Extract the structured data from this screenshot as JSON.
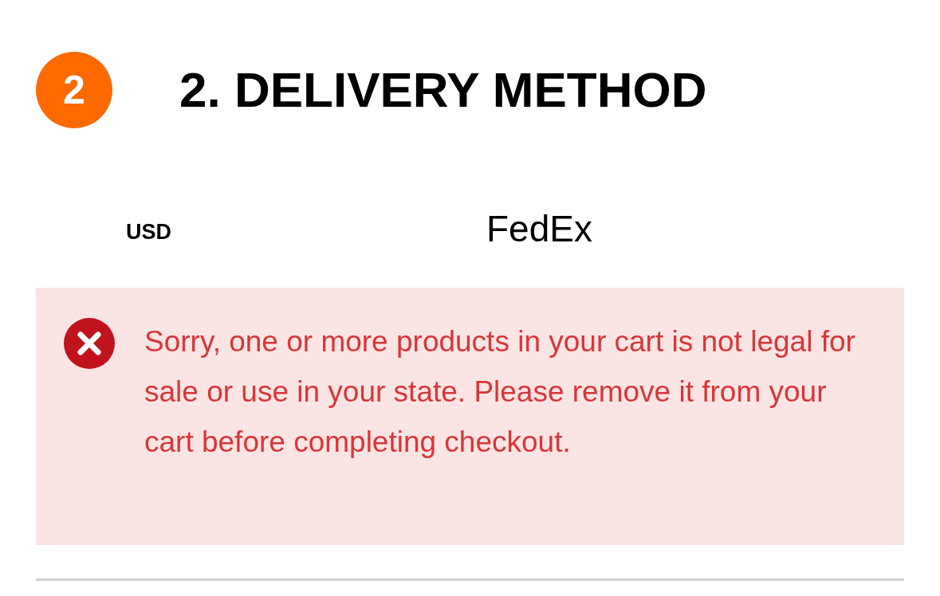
{
  "step": {
    "number": "2",
    "title": "2. DELIVERY METHOD"
  },
  "shipping": {
    "currency": "USD",
    "carrier": "FedEx"
  },
  "alert": {
    "kind": "error",
    "message": "Sorry, one or more products in your cart is not legal for sale or use in your state. Please remove it from your cart before completing checkout."
  }
}
